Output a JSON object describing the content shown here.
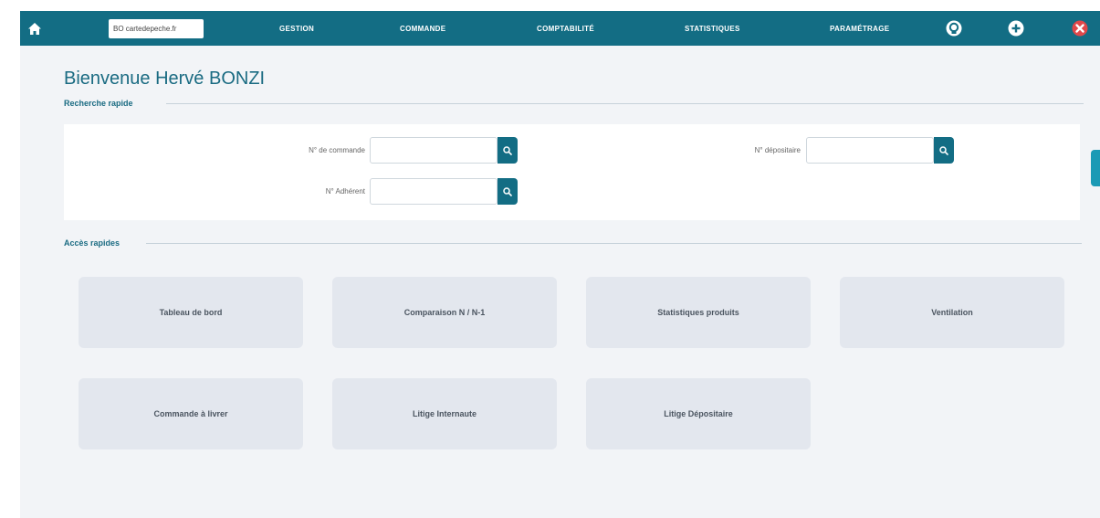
{
  "header": {
    "site_selector": "BO cartedepeche.fr",
    "menu": [
      "GESTION",
      "COMMANDE",
      "COMPTABILITÉ",
      "STATISTIQUES",
      "PARAMÉTRAGE"
    ]
  },
  "page": {
    "title": "Bienvenue Hervé BONZI"
  },
  "quick_search": {
    "label": "Recherche rapide",
    "fields": [
      {
        "label": "N° de commande",
        "value": "",
        "placeholder": ""
      },
      {
        "label": "N° dépositaire",
        "value": "",
        "placeholder": ""
      },
      {
        "label": "N° Adhérent",
        "value": "",
        "placeholder": ""
      }
    ]
  },
  "quick_access": {
    "label": "Accès rapides",
    "tiles": [
      "Tableau de bord",
      "Comparaison N / N-1",
      "Statistiques produits",
      "Ventilation",
      "Commande à livrer",
      "Litige Internaute",
      "Litige Dépositaire"
    ]
  },
  "colors": {
    "brand": "#136d84",
    "tile_bg": "#e3e7ee",
    "close_red": "#e0484a"
  },
  "icons": [
    "home-icon",
    "support-icon",
    "add-icon",
    "close-icon",
    "search-icon"
  ]
}
